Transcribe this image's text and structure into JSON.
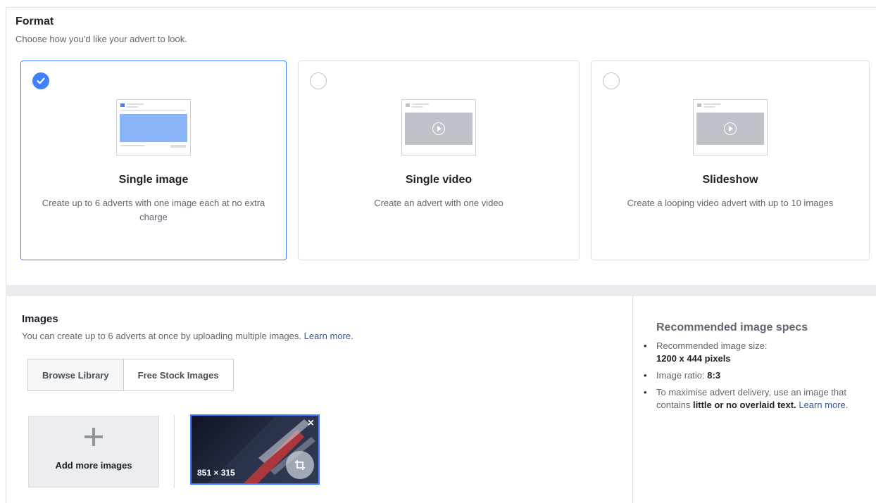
{
  "format": {
    "title": "Format",
    "subtitle": "Choose how you'd like your advert to look.",
    "options": [
      {
        "title": "Single image",
        "description": "Create up to 6 adverts with one image each at no extra charge",
        "selected": true
      },
      {
        "title": "Single video",
        "description": "Create an advert with one video",
        "selected": false
      },
      {
        "title": "Slideshow",
        "description": "Create a looping video advert with up to 10 images",
        "selected": false
      }
    ]
  },
  "images": {
    "title": "Images",
    "subtitle": "You can create up to 6 adverts at once by uploading multiple images.",
    "learn_more": "Learn more.",
    "browse_library": "Browse Library",
    "free_stock": "Free Stock Images",
    "add_more": "Add more images",
    "uploaded": [
      {
        "dimensions": "851 × 315",
        "close": "×"
      }
    ]
  },
  "specs": {
    "title": "Recommended image specs",
    "size_label": "Recommended image size:",
    "size_value": "1200 x 444 pixels",
    "ratio_label": "Image ratio: ",
    "ratio_value": "8:3",
    "tip_pre": "To maximise advert delivery, use an image that contains ",
    "tip_strong": "little or no overlaid text.",
    "tip_link": "Learn more."
  },
  "colors": {
    "accent": "#4080ff",
    "link": "#365899",
    "muted_text": "#606770"
  }
}
